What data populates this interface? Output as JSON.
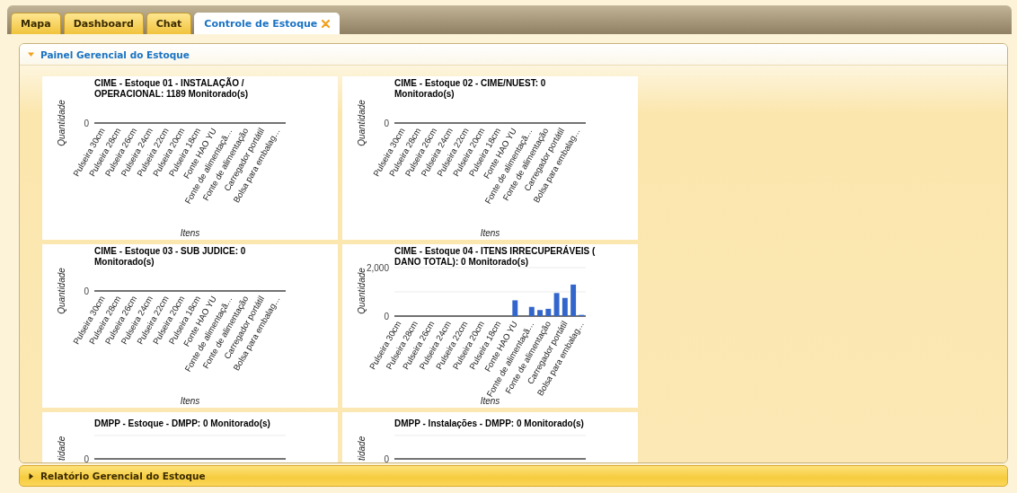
{
  "tabs": [
    {
      "label": "Mapa",
      "selected": false,
      "closable": false
    },
    {
      "label": "Dashboard",
      "selected": false,
      "closable": false
    },
    {
      "label": "Chat",
      "selected": false,
      "closable": false
    },
    {
      "label": "Controle de Estoque",
      "selected": true,
      "closable": true
    }
  ],
  "panels": [
    {
      "title": "Painel Gerencial do Estoque",
      "expanded": true,
      "charts": [
        {
          "kind": "flat",
          "title_lines": [
            "CIME - Estoque 01 - INSTALAÇÃO /",
            "OPERACIONAL: 1189 Monitorado(s)"
          ],
          "ylabel": "Quantidade",
          "y_tick": "0",
          "xlabel": "Itens",
          "x_labels": [
            "Pulseira 30cm",
            "Pulseira 28cm",
            "Pulseira 26cm",
            "Pulseira 24cm",
            "Pulseira 22cm",
            "Pulseira 20cm",
            "Pulseira 18cm",
            "Fonte HAO YU",
            "Fonte de alimentaçã…",
            "Fonte de alimentação",
            "Carregador portátil",
            "Bolsa para embalag…"
          ]
        },
        {
          "kind": "flat",
          "title_lines": [
            "CIME - Estoque 02 - CIME/NUEST: 0",
            "Monitorado(s)"
          ],
          "ylabel": "Quantidade",
          "y_tick": "0",
          "xlabel": "Itens",
          "x_labels": [
            "Pulseira 30cm",
            "Pulseira 28cm",
            "Pulseira 26cm",
            "Pulseira 24cm",
            "Pulseira 22cm",
            "Pulseira 20cm",
            "Pulseira 18cm",
            "Fonte HAO YU",
            "Fonte de alimentaçã…",
            "Fonte de alimentação",
            "Carregador portátil",
            "Bolsa para embalag…"
          ]
        },
        {
          "kind": "flat",
          "title_lines": [
            "CIME - Estoque 03 - SUB JUDICE: 0",
            "Monitorado(s)"
          ],
          "ylabel": "Quantidade",
          "y_tick": "0",
          "xlabel": "Itens",
          "x_labels": [
            "Pulseira 30cm",
            "Pulseira 28cm",
            "Pulseira 26cm",
            "Pulseira 24cm",
            "Pulseira 22cm",
            "Pulseira 20cm",
            "Pulseira 18cm",
            "Fonte HAO YU",
            "Fonte de alimentaçã…",
            "Fonte de alimentação",
            "Carregador portátil",
            "Bolsa para embalag…"
          ]
        },
        {
          "kind": "chart",
          "chart_data": {
            "type": "bar",
            "title": "CIME - Estoque 04 - ITENS IRRECUPERÁVEIS ( DANO TOTAL): 0 Monitorado(s)",
            "xlabel": "Itens",
            "ylabel": "Quantidade",
            "categories": [
              "Pulseira 30cm",
              null,
              "Pulseira 28cm",
              null,
              "Pulseira 26cm",
              null,
              "Pulseira 24cm",
              null,
              "Pulseira 22cm",
              null,
              "Pulseira 20cm",
              null,
              "Pulseira 18cm",
              null,
              "Fonte HAO YU",
              null,
              "Fonte de alimentaçã…",
              null,
              "Fonte de alimentação",
              null,
              "Carregador portátil",
              null,
              "Bolsa para embalag…"
            ],
            "values": [
              0,
              0,
              0,
              0,
              0,
              0,
              0,
              0,
              0,
              0,
              0,
              0,
              0,
              0,
              650,
              0,
              380,
              250,
              300,
              950,
              750,
              1300,
              50
            ],
            "ylim": [
              0,
              2000
            ],
            "ref_lines": [
              {
                "axis": "y",
                "value": 1000
              }
            ],
            "yticks": [
              {
                "value": 0,
                "label": "0"
              },
              {
                "value": 2000,
                "label": "2,000"
              }
            ]
          }
        },
        {
          "kind": "flat",
          "title_lines": [
            "DMPP - Estoque - DMPP: 0 Monitorado(s)"
          ],
          "ylabel": "tidade",
          "y_tick": "0"
        },
        {
          "kind": "flat",
          "title_lines": [
            "DMPP - Instalações - DMPP: 0 Monitorado(s)"
          ],
          "ylabel": "tidade",
          "y_tick": "0"
        }
      ]
    },
    {
      "title": "Relatório Gerencial do Estoque",
      "expanded": false
    }
  ]
}
